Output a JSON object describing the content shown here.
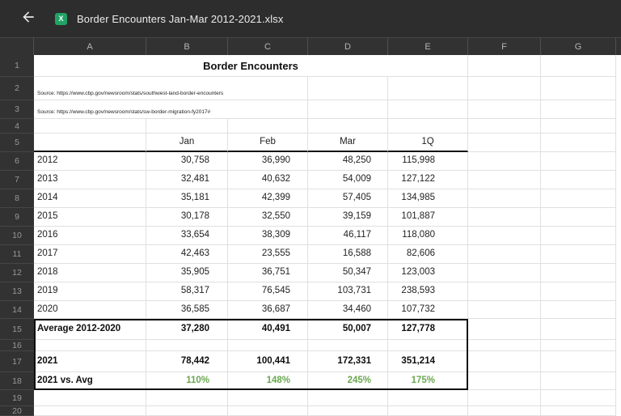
{
  "app_bar": {
    "title": "Border Encounters Jan-Mar 2012-2021.xlsx",
    "file_icon_letter": "X"
  },
  "colors": {
    "app_bar_bg": "#2d2d2d",
    "header_bg": "#323232",
    "header_text": "#b5b5b5",
    "rail_text": "#989898",
    "grid_line": "#e0e0e0",
    "cell_text": "#1f1f1f",
    "accent_green": "#6aa84f",
    "excel_icon_green": "#21a366",
    "box_border": "#0e0e0e"
  },
  "sheet": {
    "column_letters": [
      "A",
      "B",
      "C",
      "D",
      "E",
      "F",
      "G"
    ],
    "row_numbers": [
      "1",
      "2",
      "3",
      "4",
      "5",
      "6",
      "7",
      "8",
      "9",
      "10",
      "11",
      "12",
      "13",
      "14",
      "15",
      "16",
      "17",
      "18",
      "19",
      "20"
    ],
    "title": "Border Encounters",
    "sources": [
      "Source: https://www.cbp.gov/newsroom/stats/southwest-land-border-encounters",
      "Source: https://www.cbp.gov/newsroom/stats/sw-border-migration-fy2017#"
    ],
    "table": {
      "headers": [
        "Jan",
        "Feb",
        "Mar",
        "1Q"
      ],
      "rows": [
        {
          "label": "2012",
          "values": [
            "30,758",
            "36,990",
            "48,250",
            "115,998"
          ]
        },
        {
          "label": "2013",
          "values": [
            "32,481",
            "40,632",
            "54,009",
            "127,122"
          ]
        },
        {
          "label": "2014",
          "values": [
            "35,181",
            "42,399",
            "57,405",
            "134,985"
          ]
        },
        {
          "label": "2015",
          "values": [
            "30,178",
            "32,550",
            "39,159",
            "101,887"
          ]
        },
        {
          "label": "2016",
          "values": [
            "33,654",
            "38,309",
            "46,117",
            "118,080"
          ]
        },
        {
          "label": "2017",
          "values": [
            "42,463",
            "23,555",
            "16,588",
            "82,606"
          ]
        },
        {
          "label": "2018",
          "values": [
            "35,905",
            "36,751",
            "50,347",
            "123,003"
          ]
        },
        {
          "label": "2019",
          "values": [
            "58,317",
            "76,545",
            "103,731",
            "238,593"
          ]
        },
        {
          "label": "2020",
          "values": [
            "36,585",
            "36,687",
            "34,460",
            "107,732"
          ]
        }
      ],
      "summary_rows": [
        {
          "label": "Average 2012-2020",
          "values": [
            "37,280",
            "40,491",
            "50,007",
            "127,778"
          ],
          "style": "bold"
        },
        {
          "label": "2021",
          "values": [
            "78,442",
            "100,441",
            "172,331",
            "351,214"
          ],
          "style": "bold"
        },
        {
          "label": "2021 vs. Avg",
          "values": [
            "110%",
            "148%",
            "245%",
            "175%"
          ],
          "style": "percent"
        }
      ]
    }
  }
}
